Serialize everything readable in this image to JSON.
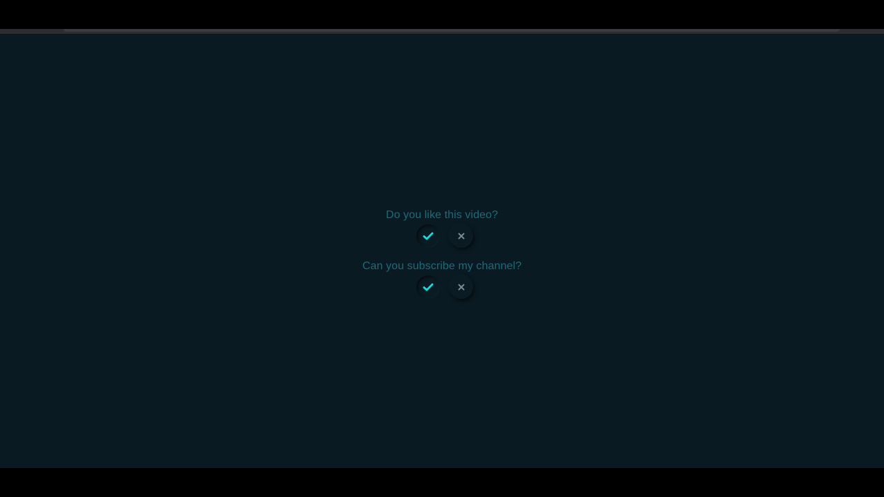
{
  "questions": [
    {
      "text": "Do you like this video?",
      "yes_selected": true
    },
    {
      "text": "Can you subscribe my channel?",
      "yes_selected": true
    }
  ],
  "colors": {
    "background": "#0a1a22",
    "question_text": "#1f6a78",
    "check_active": "#18d8d8",
    "cross": "#7a8a90"
  },
  "icons": {
    "yes": "check-icon",
    "no": "close-icon"
  }
}
